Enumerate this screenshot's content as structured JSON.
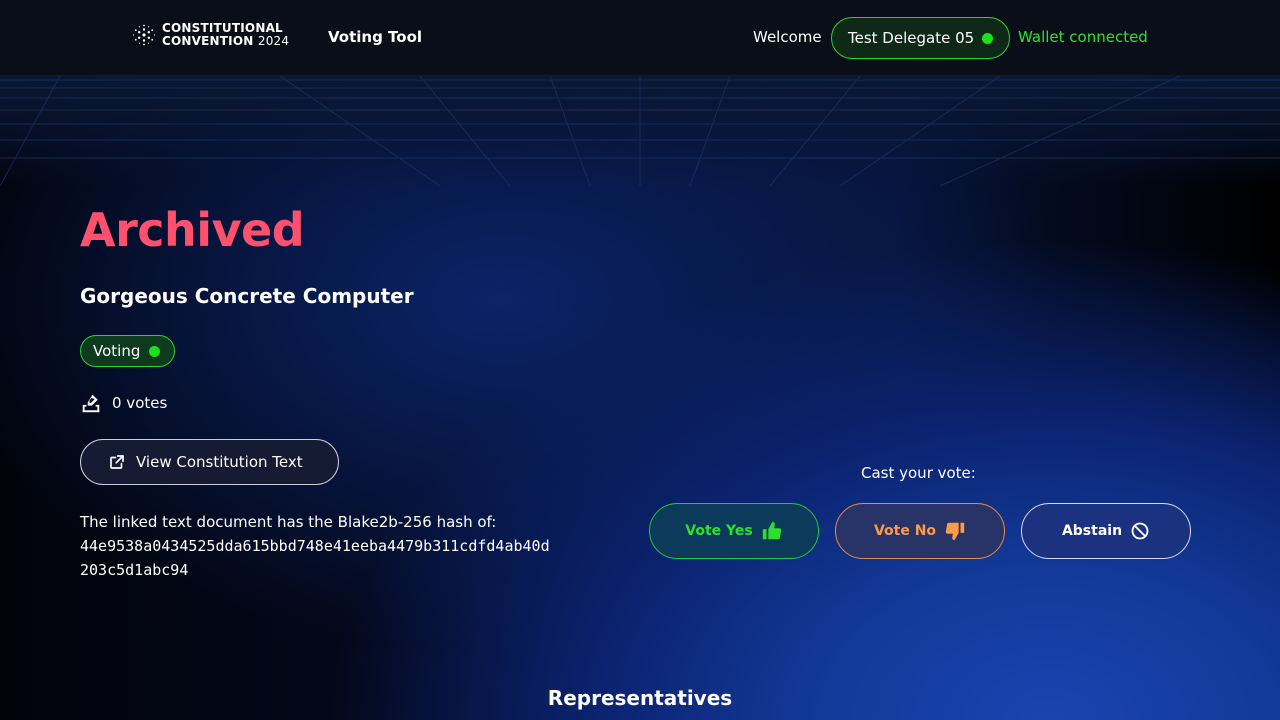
{
  "header": {
    "logo": {
      "line1": "CONSTITUTIONAL",
      "line2": "CONVENTION",
      "year": "2024"
    },
    "nav_link": "Voting Tool",
    "welcome": "Welcome",
    "user_name": "Test Delegate 05",
    "wallet_status": "Wallet connected"
  },
  "proposal": {
    "state": "Archived",
    "title": "Gorgeous Concrete Computer",
    "status": "Voting",
    "votes": "0 votes",
    "view_button": "View Constitution Text",
    "hash_label": "The linked text document has the Blake2b-256 hash of:",
    "hash_value": "44e9538a0434525dda615bbd748e41eeba4479b311cdfd4ab40d203c5d1abc94"
  },
  "voting": {
    "cast_label": "Cast your vote:",
    "yes_label": "Vote Yes",
    "no_label": "Vote No",
    "abstain_label": "Abstain"
  },
  "section_title": "Representatives",
  "colors": {
    "accent_green": "#2ee02e",
    "archived_red": "#ff506e",
    "vote_no_orange": "#ff9a4a"
  },
  "icons": {
    "logo": "cardano-logo-icon",
    "status_dot": "green-dot-icon",
    "votes": "ballot-box-icon",
    "external_link": "external-link-icon",
    "yes": "thumbs-up-icon",
    "no": "thumbs-down-icon",
    "abstain": "ban-icon"
  }
}
